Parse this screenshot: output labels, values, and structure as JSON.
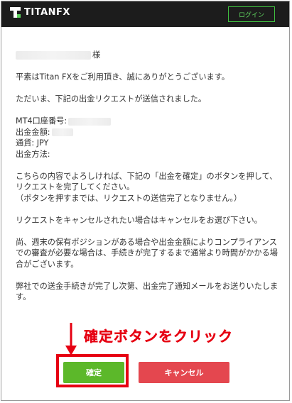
{
  "header": {
    "logo_text": "TITANFX",
    "login_label": "ログイン"
  },
  "email": {
    "salutation_suffix": "様",
    "greeting": "平素はTitan FXをご利用頂き、誠にありがとうございます。",
    "intro": "ただいま、下記の出金リクエストが送信されました。",
    "details": {
      "account_label": "MT4口座番号:",
      "amount_label": "出金金額:",
      "currency_label": "通貨: JPY",
      "method_label": "出金方法:"
    },
    "instruction_1": "こちらの内容でよろしければ、下記の「出金を確定」のボタンを押して、リクエストを完了してください。",
    "instruction_2": "（ボタンを押すまでは、リクエストの送信完了となりません。）",
    "cancel_note": "リクエストをキャンセルされたい場合はキャンセルをお選び下さい。",
    "compliance_note": "尚、週末の保有ポジションがある場合や出金金額によりコンプライアンスでの審査が必要な場合は、手続きが完了するまで通常より時間がかかる場合がございます。",
    "closing_note": "弊社での送金手続きが完了し次第、出金完了通知メールをお送りいたします。"
  },
  "buttons": {
    "confirm_label": "確定",
    "cancel_label": "キャンセル"
  },
  "annotation": {
    "label": "確定ボタンをクリック",
    "color": "#e60012"
  },
  "colors": {
    "header_bg": "#1c1c1c",
    "login_border": "#3fbf3f",
    "confirm_bg": "#5cb82a",
    "cancel_bg": "#e4474f"
  }
}
